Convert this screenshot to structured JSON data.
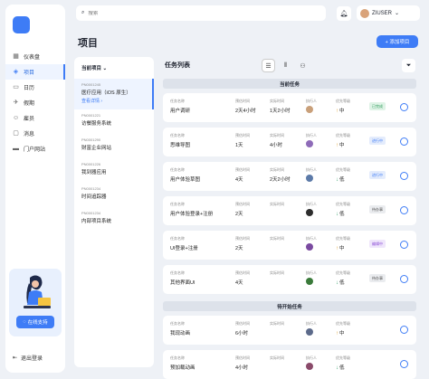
{
  "sidebar": {
    "items": [
      {
        "label": "仪表盘",
        "icon": "grid-icon"
      },
      {
        "label": "项目",
        "icon": "cube-icon",
        "active": true
      },
      {
        "label": "日历",
        "icon": "calendar-icon"
      },
      {
        "label": "假期",
        "icon": "plane-icon"
      },
      {
        "label": "雇员",
        "icon": "users-icon"
      },
      {
        "label": "消息",
        "icon": "message-icon"
      },
      {
        "label": "门户网站",
        "icon": "folder-icon"
      }
    ],
    "support_label": "在线支持",
    "logout_label": "退出登录"
  },
  "search": {
    "placeholder": "搜索"
  },
  "user": {
    "name": "ZIUSER"
  },
  "page": {
    "title": "项目",
    "add_label": "+ 添加项目"
  },
  "projects": {
    "header": "当前项目",
    "items": [
      {
        "code": "PN0001245",
        "name": "医疗应用（iOS 原生）",
        "link": "查看详情",
        "active": true
      },
      {
        "code": "PN0001221",
        "name": "访餐服务系统"
      },
      {
        "code": "PN0001290",
        "name": "财富企业网站"
      },
      {
        "code": "PN0001226",
        "name": "我到器应用"
      },
      {
        "code": "PN0001234",
        "name": "时间追踪器"
      },
      {
        "code": "PN0001234",
        "name": "内部项目系统"
      }
    ]
  },
  "tasks": {
    "title": "任务列表",
    "labels": {
      "name": "任务名称",
      "est": "预估时间",
      "act": "实际时间",
      "exec": "执行人",
      "pri": "优先等级"
    },
    "sections": [
      {
        "title": "当前任务",
        "rows": [
          {
            "name": "用户调研",
            "est": "2天4小时",
            "act": "1天2小时",
            "pri": "中",
            "pri_dir": "mid",
            "status": "已完成",
            "status_class": "st-green",
            "avatar": "#c9a07a"
          },
          {
            "name": "思维导图",
            "est": "1天",
            "act": "4小时",
            "pri": "中",
            "pri_dir": "mid",
            "status": "进行中",
            "status_class": "st-blue",
            "avatar": "#8e6bb8"
          },
          {
            "name": "用户体验草图",
            "est": "4天",
            "act": "2天2小时",
            "pri": "低",
            "pri_dir": "down",
            "status": "进行中",
            "status_class": "st-blue",
            "avatar": "#5c7aa8"
          },
          {
            "name": "用户体验登录+注册",
            "est": "2天",
            "act": "",
            "pri": "低",
            "pri_dir": "down",
            "status": "待办事",
            "status_class": "st-gray",
            "avatar": "#2d2d2d"
          },
          {
            "name": "UI登录+注册",
            "est": "2天",
            "act": "",
            "pri": "中",
            "pri_dir": "mid",
            "status": "编辑中",
            "status_class": "st-purple",
            "avatar": "#7a4aa0"
          },
          {
            "name": "其他界面UI",
            "est": "4天",
            "act": "",
            "pri": "低",
            "pri_dir": "down",
            "status": "待办事",
            "status_class": "st-gray",
            "avatar": "#3a7a3a"
          }
        ]
      },
      {
        "title": "待开始任务",
        "rows": [
          {
            "name": "我现动画",
            "est": "6小时",
            "act": "",
            "pri": "中",
            "pri_dir": "mid",
            "avatar": "#5c6a8a"
          },
          {
            "name": "预加载动画",
            "est": "4小时",
            "act": "",
            "pri": "低",
            "pri_dir": "down",
            "avatar": "#8a4a6a"
          }
        ]
      }
    ]
  }
}
